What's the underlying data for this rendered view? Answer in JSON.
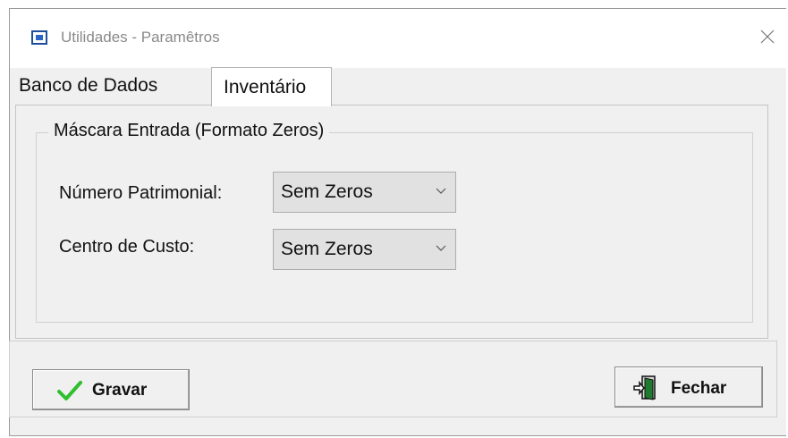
{
  "window": {
    "title": "Utilidades - Parametros",
    "title_display": "Utilidades - Paramêtros",
    "app_icon": "window-app-icon",
    "close_icon": "close-icon"
  },
  "tabs": [
    {
      "label": "Banco de Dados",
      "active": false
    },
    {
      "label": "Inventário",
      "active": true
    }
  ],
  "group": {
    "legend": "Máscara Entrada (Formato Zeros)",
    "fields": [
      {
        "label": "Número Patrimonial:",
        "value": "Sem Zeros"
      },
      {
        "label": "Centro de Custo:",
        "value": "Sem Zeros"
      }
    ]
  },
  "footer": {
    "save_label": "Gravar",
    "save_icon": "checkmark-icon",
    "close_label": "Fechar",
    "close_icon": "exit-door-icon"
  },
  "colors": {
    "window_bg": "#f0f0f0",
    "accent_green": "#2fbf2f",
    "door_green": "#1e7a2e"
  }
}
